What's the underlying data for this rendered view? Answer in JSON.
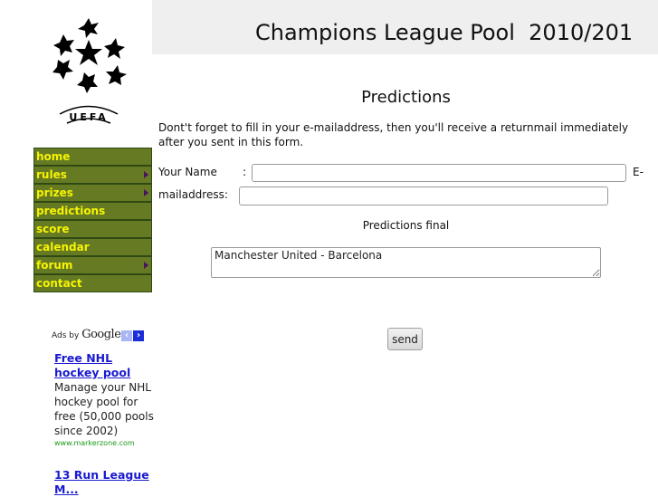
{
  "header": {
    "title": "Champions League Pool  2010/201"
  },
  "logo": {
    "icon": "starball-icon",
    "text": "UEFA"
  },
  "menu": {
    "items": [
      {
        "label": "home",
        "has_submenu": false
      },
      {
        "label": "rules",
        "has_submenu": true
      },
      {
        "label": "prizes",
        "has_submenu": true
      },
      {
        "label": "predictions",
        "has_submenu": false
      },
      {
        "label": "score",
        "has_submenu": false
      },
      {
        "label": "calendar",
        "has_submenu": false
      },
      {
        "label": "forum",
        "has_submenu": true
      },
      {
        "label": "contact",
        "has_submenu": false
      }
    ],
    "colors": {
      "background": "#667a24",
      "text": "#f6f400",
      "border": "#2e4a12",
      "arrow": "#4a1060"
    }
  },
  "ads": {
    "label_prefix": "Ads by",
    "label_brand": "Google",
    "prev_icon": "‹",
    "next_icon": "›",
    "items": [
      {
        "title": "Free NHL hockey pool",
        "body": "Manage your NHL hockey pool for free (50,000 pools since 2002)",
        "url": "www.markerzone.com"
      },
      {
        "title": "13 Run League M..."
      }
    ]
  },
  "main": {
    "page_title": "Predictions",
    "intro": "Dont't forget to fill in your e-mailaddress, then you'll receive a returnmail immediately after you sent in this form.",
    "name_label": "Your Name",
    "name_colon": ":",
    "name_value": "",
    "email_label_part1": "E-",
    "email_label_part2": "mailaddress:",
    "email_value": "",
    "predictions_label": "Predictions final",
    "predictions_value": "Manchester United - Barcelona",
    "send_label": "send"
  }
}
